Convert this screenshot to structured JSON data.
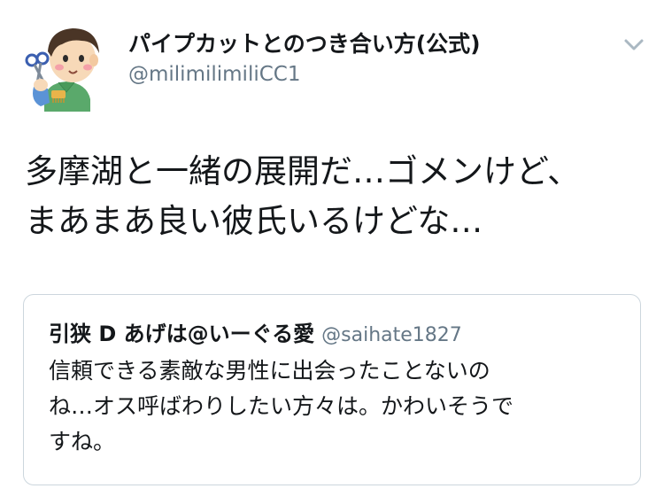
{
  "tweet": {
    "author": {
      "display_name": "パイプカットとのつき合い方(公式)",
      "handle": "@milimilimiliCC1",
      "avatar_icon": "barber-boy-avatar-icon"
    },
    "menu_icon": "chevron-down-icon",
    "text": "多摩湖と一緒の展開だ…ゴメンけど、\nまあまあ良い彼氏いるけどな…",
    "quoted_tweet": {
      "display_name": "引狭 D あげは@いーぐる愛",
      "handle": "@saihate1827",
      "text": "信頼できる素敵な男性に出会ったことないの\nね…オス呼ばわりしたい方々は。かわいそうで\nすね。"
    }
  },
  "colors": {
    "text_primary": "#14171a",
    "text_secondary": "#657786",
    "border": "#ccd6dd",
    "chevron": "#aab8c2"
  }
}
